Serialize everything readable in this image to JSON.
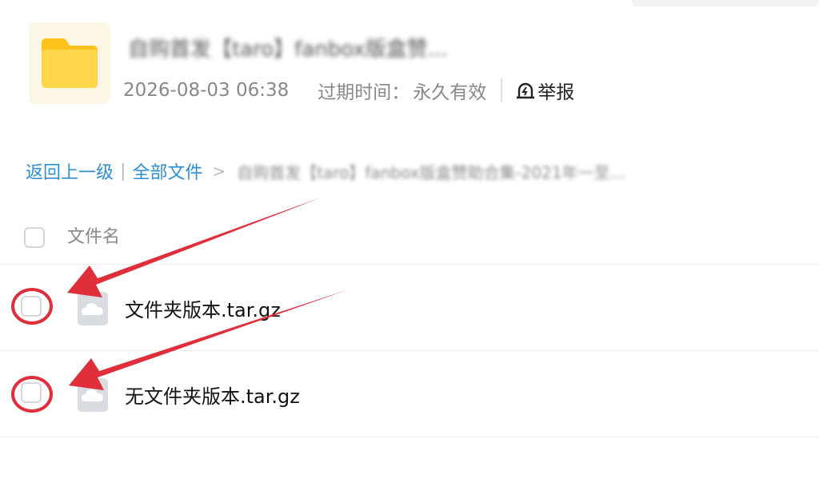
{
  "header": {
    "share_title": "自购首发【taro】fanbox版盒赞...",
    "share_date": "2026-08-03 06:38",
    "expire_label": "过期时间：",
    "expire_value": "永久有效",
    "report_label": "举报"
  },
  "breadcrumb": {
    "back_label": "返回上一级",
    "separator": "|",
    "all_files_label": "全部文件",
    "arrow": ">",
    "current_folder": "自购首发【taro】fanbox版盒赞助合集-2021年一至..."
  },
  "list": {
    "column_header": "文件名",
    "files": [
      {
        "name": "文件夹版本.tar.gz",
        "icon": "cloud-file-icon",
        "checked": false
      },
      {
        "name": "无文件夹版本.tar.gz",
        "icon": "cloud-file-icon",
        "checked": false
      }
    ]
  },
  "colors": {
    "accent_link": "#2b8fd6",
    "annotation_red": "#e02f3b",
    "folder_yellow": "#ffcc33"
  }
}
